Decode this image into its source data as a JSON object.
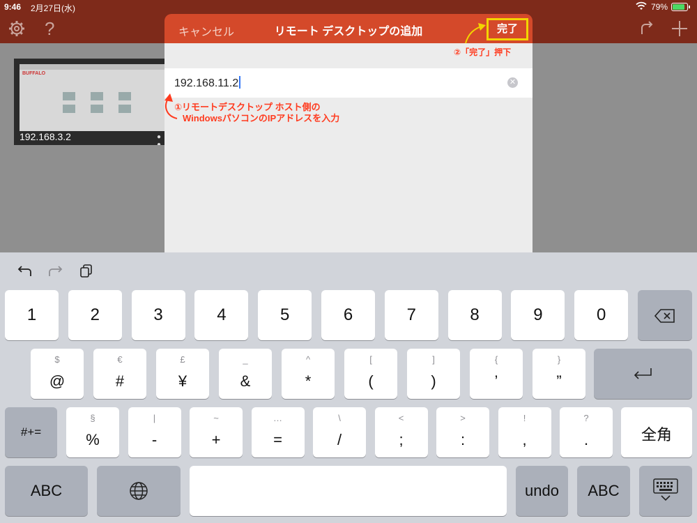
{
  "status_bar": {
    "time": "9:46",
    "date": "2月27日(水)",
    "battery": "79%"
  },
  "toolbar": {
    "settings_icon": "gear-icon",
    "help_icon": "help-icon",
    "redo_icon": "redo-arrow-icon",
    "add_icon": "plus-icon"
  },
  "connection": {
    "label": "192.168.3.2",
    "brand": "BUFFALO"
  },
  "dialog": {
    "cancel": "キャンセル",
    "title": "リモート デスクトップの追加",
    "done": "完了",
    "input_value": "192.168.11.2"
  },
  "annotations": {
    "step1_line1": "①リモートデスクトップ ホスト側の",
    "step1_line2": "WindowsパソコンのIPアドレスを入力",
    "step2": "②「完了」押下"
  },
  "keyboard": {
    "row1": [
      "1",
      "2",
      "3",
      "4",
      "5",
      "6",
      "7",
      "8",
      "9",
      "0"
    ],
    "row2": [
      {
        "sub": "$",
        "main": "@"
      },
      {
        "sub": "€",
        "main": "#"
      },
      {
        "sub": "£",
        "main": "¥"
      },
      {
        "sub": "_",
        "main": "&"
      },
      {
        "sub": "^",
        "main": "*"
      },
      {
        "sub": "[",
        "main": "("
      },
      {
        "sub": "]",
        "main": ")"
      },
      {
        "sub": "{",
        "main": "’"
      },
      {
        "sub": "}",
        "main": "”"
      }
    ],
    "row3": [
      {
        "sub": "§",
        "main": "%"
      },
      {
        "sub": "|",
        "main": "-"
      },
      {
        "sub": "~",
        "main": "+"
      },
      {
        "sub": "…",
        "main": "="
      },
      {
        "sub": "\\",
        "main": "/"
      },
      {
        "sub": "<",
        "main": ";"
      },
      {
        "sub": ">",
        "main": ":"
      },
      {
        "sub": "!",
        "main": ","
      },
      {
        "sub": "?",
        "main": "."
      }
    ],
    "symbols_key": "#+=",
    "kana_key": "全角",
    "abc_left": "ABC",
    "undo": "undo",
    "abc_right": "ABC"
  }
}
